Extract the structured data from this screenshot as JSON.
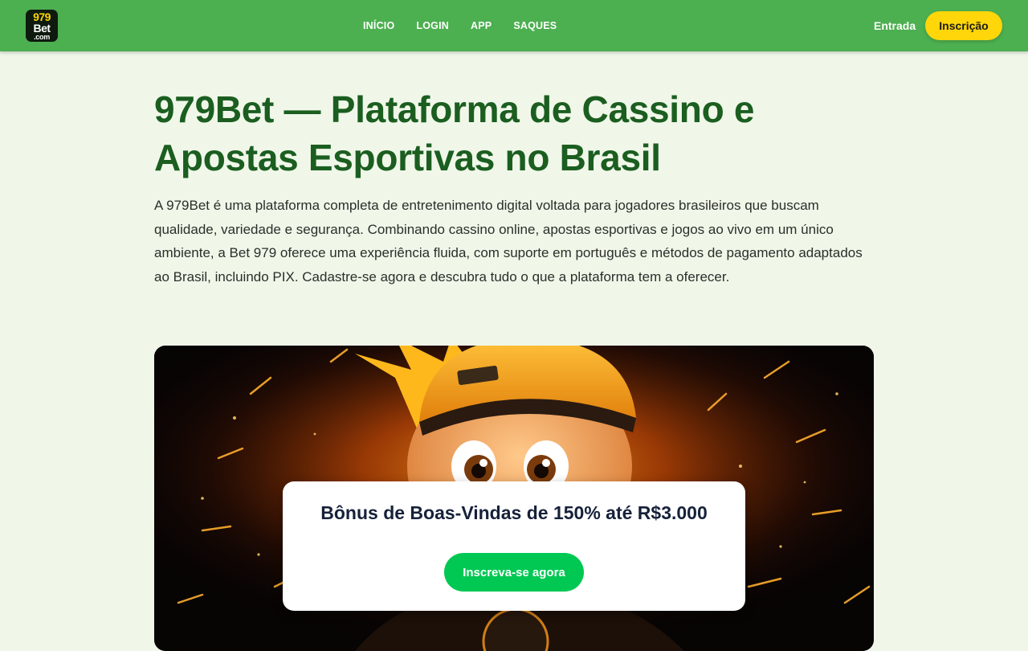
{
  "header": {
    "logo": {
      "line1": "979",
      "line2": "Bet",
      "line3": ".com"
    },
    "nav": [
      {
        "label": "INÍCIO"
      },
      {
        "label": "LOGIN"
      },
      {
        "label": "APP"
      },
      {
        "label": "SAQUES"
      }
    ],
    "entrada_label": "Entrada",
    "inscricao_label": "Inscrição"
  },
  "main": {
    "title": "979Bet — Plataforma de Cassino e Apostas Esportivas no Brasil",
    "intro": "A 979Bet é uma plataforma completa de entretenimento digital voltada para jogadores brasileiros que buscam qualidade, variedade e segurança. Combinando cassino online, apostas esportivas e jogos ao vivo em um único ambiente, a Bet 979 oferece uma experiência fluida, com suporte em português e métodos de pagamento adaptados ao Brasil, incluindo PIX. Cadastre-se agora e descubra tudo o que a plataforma tem a oferecer."
  },
  "promo": {
    "title": "Bônus de Boas-Vindas de 150% até R$3.000",
    "button_label": "Inscreva-se agora"
  },
  "colors": {
    "header_bg": "#4caf50",
    "title": "#1b5e20",
    "signup_yellow": "#ffd60a",
    "cta_green": "#00c853",
    "page_bg": "#f0f7e9"
  }
}
